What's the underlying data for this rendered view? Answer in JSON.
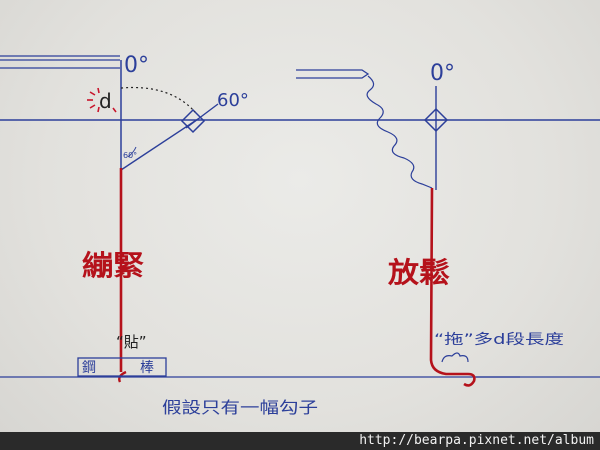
{
  "left_diagram": {
    "zero_label": "0°",
    "sixty_label": "60°",
    "small_angle_label": "60°",
    "d_label": "d",
    "state_label": "繃緊",
    "note_label": "“貼”",
    "rod_label": [
      "鋼",
      "棒"
    ]
  },
  "right_diagram": {
    "zero_label": "0°",
    "state_label": "放鬆",
    "note_label": "“拖”多d段長度"
  },
  "caption": "假設只有一幅勾子",
  "watermark": "http://bearpa.pixnet.net/album",
  "colors": {
    "ink_blue": "#2c3f9a",
    "ink_red": "#b5121b"
  }
}
